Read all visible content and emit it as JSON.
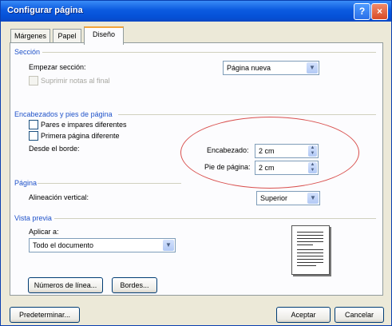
{
  "window": {
    "title": "Configurar página",
    "help_glyph": "?",
    "close_glyph": "×"
  },
  "tabs": [
    {
      "label": "Márgenes",
      "active": false
    },
    {
      "label": "Papel",
      "active": false
    },
    {
      "label": "Diseño",
      "active": true
    }
  ],
  "section": {
    "heading": "Sección",
    "start_label": "Empezar sección:",
    "start_value": "Página nueva",
    "suppress_endnotes": "Suprimir notas al final"
  },
  "headers": {
    "heading": "Encabezados y pies de página",
    "odd_even": "Pares e impares diferentes",
    "first_page": "Primera página diferente",
    "from_edge": "Desde el borde:",
    "header_label": "Encabezado:",
    "header_value": "2 cm",
    "footer_label": "Pie de página:",
    "footer_value": "2 cm"
  },
  "page": {
    "heading": "Página",
    "valign_label": "Alineación vertical:",
    "valign_value": "Superior"
  },
  "preview": {
    "heading": "Vista previa",
    "apply_label": "Aplicar a:",
    "apply_value": "Todo el documento"
  },
  "buttons": {
    "line_numbers": "Números de línea...",
    "borders": "Bordes...",
    "default": "Predeterminar...",
    "ok": "Aceptar",
    "cancel": "Cancelar"
  },
  "icons": {
    "dropdown": "▼",
    "spin_up": "▲",
    "spin_down": "▼"
  },
  "colors": {
    "titlebar": "#0b5ae0",
    "section_heading": "#1f52c9",
    "annotation_ellipse": "#d9504e",
    "tab_highlight": "#f2a43a"
  }
}
